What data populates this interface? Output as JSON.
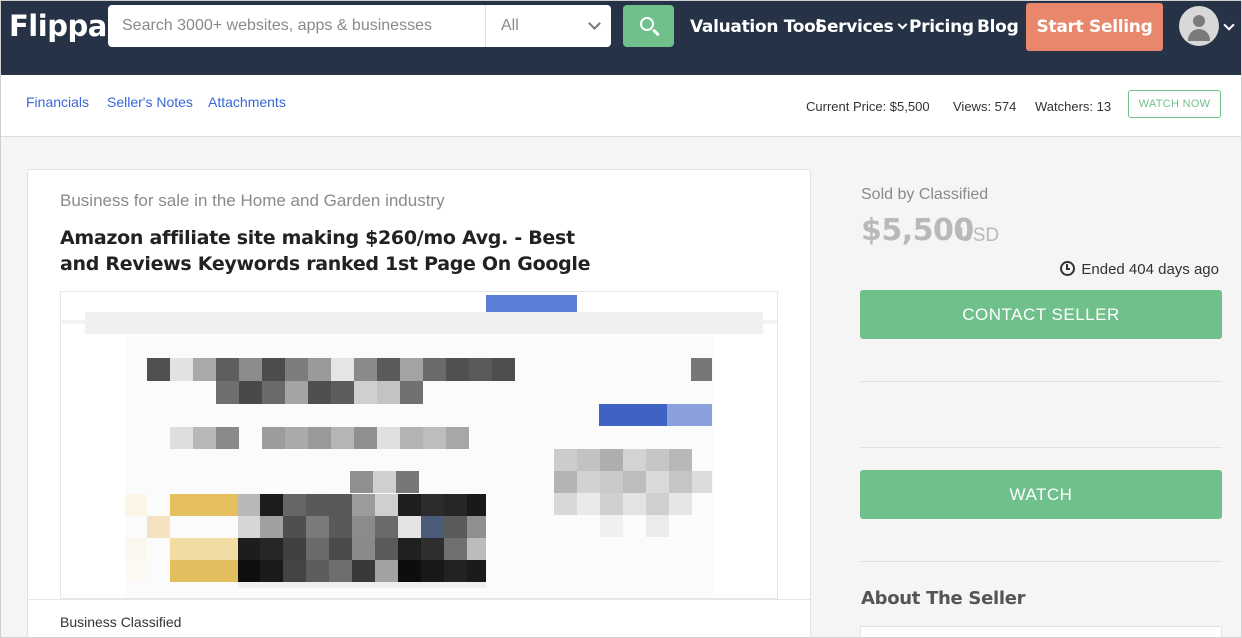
{
  "header": {
    "logo": "Flippa",
    "search_placeholder": "Search 3000+ websites, apps & businesses",
    "category_selected": "All",
    "nav": {
      "valuation": "Valuation Tool",
      "services": "Services",
      "pricing": "Pricing",
      "blog": "Blog"
    },
    "start_selling": "Start Selling"
  },
  "subnav": {
    "links": [
      "Financials",
      "Seller's Notes",
      "Attachments"
    ],
    "current_price": "Current Price: $5,500",
    "views": "Views: 574",
    "watchers": "Watchers: 13",
    "watch_now": "WATCH NOW"
  },
  "listing": {
    "industry": "Business for sale in the Home and Garden industry",
    "title": "Amazon affiliate site making $260/mo Avg. - Best and Reviews Keywords ranked 1st Page On Google",
    "footer_label": "Business Classified"
  },
  "sidebar": {
    "sold_by": "Sold by Classified",
    "price": "$5,500",
    "currency": "USD",
    "ended": "Ended 404 days ago",
    "contact": "CONTACT SELLER",
    "watch": "WATCH",
    "about": "About The Seller"
  },
  "icons": [
    "search-icon",
    "chevron-down-icon",
    "user-avatar-icon",
    "clock-icon"
  ],
  "colors": {
    "header_bg": "#263246",
    "green": "#6fc08a",
    "orange": "#e8876b",
    "link_blue": "#3a66d9"
  }
}
